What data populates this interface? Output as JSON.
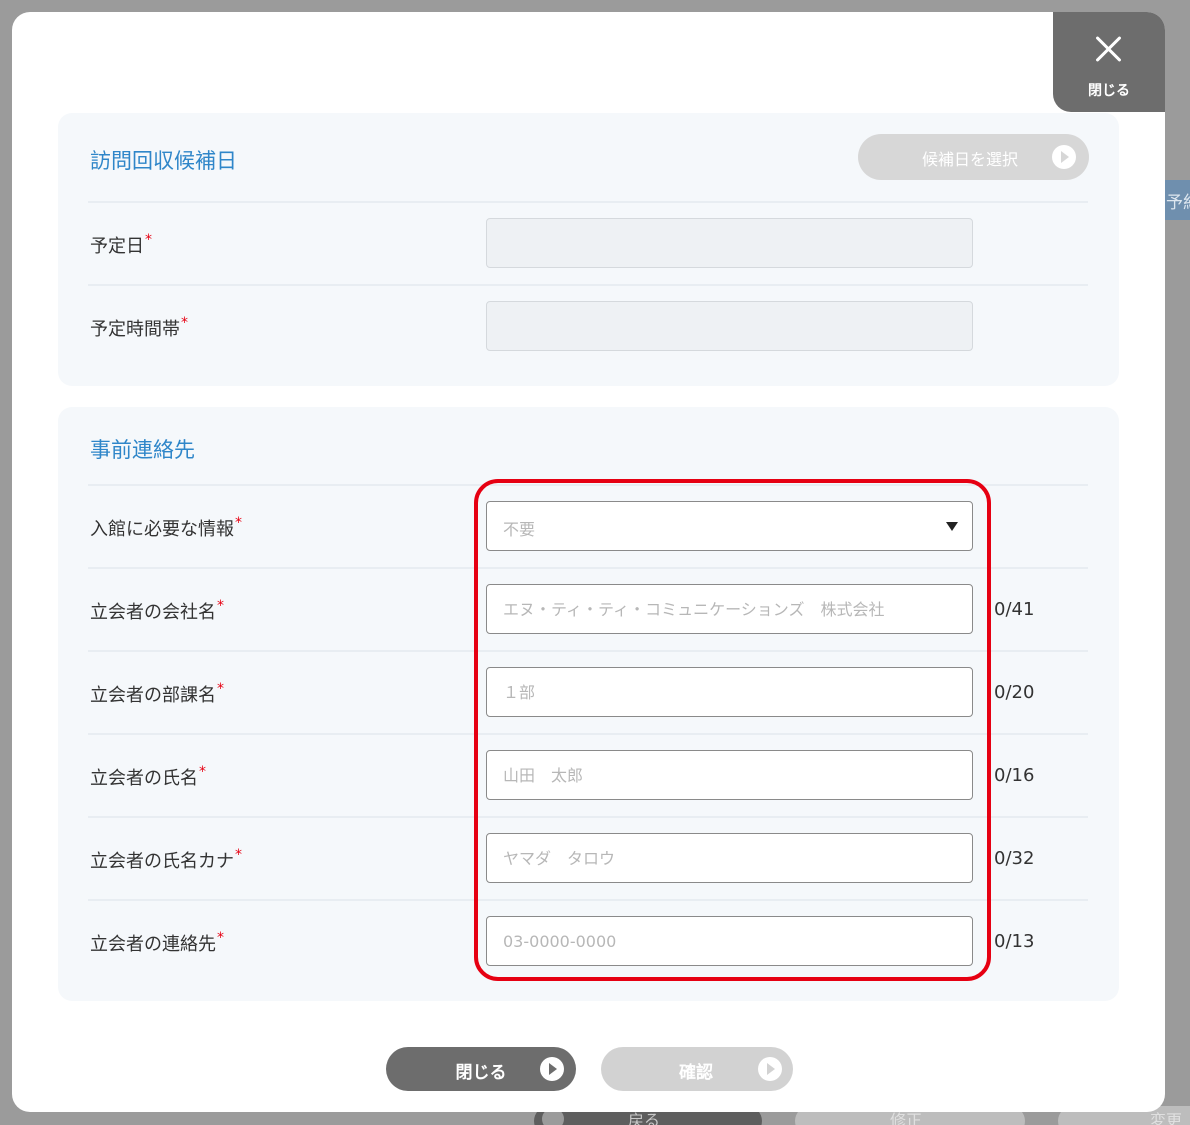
{
  "background": {
    "side_tab_text": "予約",
    "back_button": "戻る",
    "mid_button": "修正",
    "right_button": "変更"
  },
  "close_tab": {
    "label": "閉じる"
  },
  "visit_section": {
    "title": "訪問回収候補日",
    "pick_button": "候補日を選択",
    "fields": [
      {
        "label": "予定日",
        "required_mark": "*"
      },
      {
        "label": "予定時間帯",
        "required_mark": "*"
      }
    ]
  },
  "contact_section": {
    "title": "事前連絡先",
    "entry_info": {
      "label": "入館に必要な情報",
      "required_mark": "*",
      "selected": "不要"
    },
    "fields": [
      {
        "label": "立会者の会社名",
        "required_mark": "*",
        "placeholder": "エヌ・ティ・ティ・コミュニケーションズ　株式会社",
        "counter": "0/41"
      },
      {
        "label": "立会者の部課名",
        "required_mark": "*",
        "placeholder": "１部",
        "counter": "0/20"
      },
      {
        "label": "立会者の氏名",
        "required_mark": "*",
        "placeholder": "山田　太郎",
        "counter": "0/16"
      },
      {
        "label": "立会者の氏名カナ",
        "required_mark": "*",
        "placeholder": "ヤマダ　タロウ",
        "counter": "0/32"
      },
      {
        "label": "立会者の連絡先",
        "required_mark": "*",
        "placeholder": "03-0000-0000",
        "counter": "0/13"
      }
    ]
  },
  "footer": {
    "close_label": "閉じる",
    "confirm_label": "確認"
  },
  "colors": {
    "accent": "#2f86c9",
    "required": "#e60012",
    "highlight": "#e60012"
  }
}
